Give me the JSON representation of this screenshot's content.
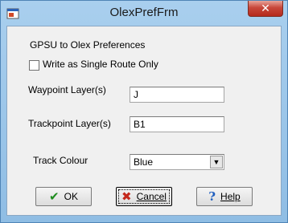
{
  "window": {
    "title": "OlexPrefFrm",
    "close_glyph": "✕"
  },
  "form": {
    "heading": "GPSU to Olex Preferences",
    "single_route_checkbox": {
      "label": "Write as Single Route Only",
      "checked": false
    },
    "waypoint_layer": {
      "label": "Waypoint Layer(s)",
      "value": "J"
    },
    "trackpoint_layer": {
      "label": "Trackpoint Layer(s)",
      "value": "B1"
    },
    "track_colour": {
      "label": "Track Colour",
      "value": "Blue",
      "arrow": "▼"
    }
  },
  "buttons": {
    "ok": {
      "label": "OK",
      "icon": "check-icon",
      "glyph": "✔"
    },
    "cancel": {
      "label": "Cancel",
      "icon": "cross-icon",
      "glyph": "✖"
    },
    "help": {
      "label": "Help",
      "icon": "question-icon",
      "glyph": "?"
    }
  },
  "colors": {
    "title_bar": "#9cc6ea",
    "close_button": "#c7473a",
    "client": "#f0f0f0"
  }
}
